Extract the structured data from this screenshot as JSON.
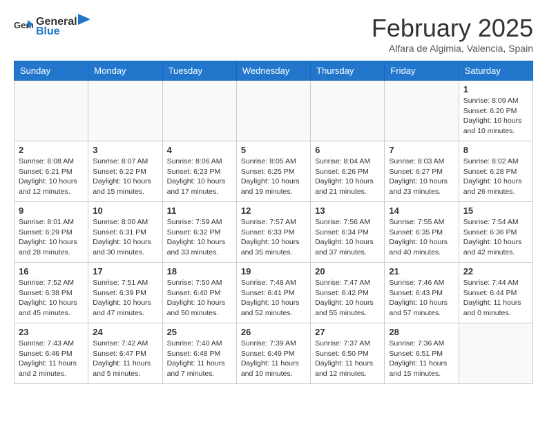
{
  "header": {
    "logo": {
      "general": "General",
      "blue": "Blue"
    },
    "month": "February 2025",
    "location": "Alfara de Algimia, Valencia, Spain"
  },
  "days_of_week": [
    "Sunday",
    "Monday",
    "Tuesday",
    "Wednesday",
    "Thursday",
    "Friday",
    "Saturday"
  ],
  "weeks": [
    [
      {
        "day": "",
        "info": ""
      },
      {
        "day": "",
        "info": ""
      },
      {
        "day": "",
        "info": ""
      },
      {
        "day": "",
        "info": ""
      },
      {
        "day": "",
        "info": ""
      },
      {
        "day": "",
        "info": ""
      },
      {
        "day": "1",
        "info": "Sunrise: 8:09 AM\nSunset: 6:20 PM\nDaylight: 10 hours\nand 10 minutes."
      }
    ],
    [
      {
        "day": "2",
        "info": "Sunrise: 8:08 AM\nSunset: 6:21 PM\nDaylight: 10 hours\nand 12 minutes."
      },
      {
        "day": "3",
        "info": "Sunrise: 8:07 AM\nSunset: 6:22 PM\nDaylight: 10 hours\nand 15 minutes."
      },
      {
        "day": "4",
        "info": "Sunrise: 8:06 AM\nSunset: 6:23 PM\nDaylight: 10 hours\nand 17 minutes."
      },
      {
        "day": "5",
        "info": "Sunrise: 8:05 AM\nSunset: 6:25 PM\nDaylight: 10 hours\nand 19 minutes."
      },
      {
        "day": "6",
        "info": "Sunrise: 8:04 AM\nSunset: 6:26 PM\nDaylight: 10 hours\nand 21 minutes."
      },
      {
        "day": "7",
        "info": "Sunrise: 8:03 AM\nSunset: 6:27 PM\nDaylight: 10 hours\nand 23 minutes."
      },
      {
        "day": "8",
        "info": "Sunrise: 8:02 AM\nSunset: 6:28 PM\nDaylight: 10 hours\nand 26 minutes."
      }
    ],
    [
      {
        "day": "9",
        "info": "Sunrise: 8:01 AM\nSunset: 6:29 PM\nDaylight: 10 hours\nand 28 minutes."
      },
      {
        "day": "10",
        "info": "Sunrise: 8:00 AM\nSunset: 6:31 PM\nDaylight: 10 hours\nand 30 minutes."
      },
      {
        "day": "11",
        "info": "Sunrise: 7:59 AM\nSunset: 6:32 PM\nDaylight: 10 hours\nand 33 minutes."
      },
      {
        "day": "12",
        "info": "Sunrise: 7:57 AM\nSunset: 6:33 PM\nDaylight: 10 hours\nand 35 minutes."
      },
      {
        "day": "13",
        "info": "Sunrise: 7:56 AM\nSunset: 6:34 PM\nDaylight: 10 hours\nand 37 minutes."
      },
      {
        "day": "14",
        "info": "Sunrise: 7:55 AM\nSunset: 6:35 PM\nDaylight: 10 hours\nand 40 minutes."
      },
      {
        "day": "15",
        "info": "Sunrise: 7:54 AM\nSunset: 6:36 PM\nDaylight: 10 hours\nand 42 minutes."
      }
    ],
    [
      {
        "day": "16",
        "info": "Sunrise: 7:52 AM\nSunset: 6:38 PM\nDaylight: 10 hours\nand 45 minutes."
      },
      {
        "day": "17",
        "info": "Sunrise: 7:51 AM\nSunset: 6:39 PM\nDaylight: 10 hours\nand 47 minutes."
      },
      {
        "day": "18",
        "info": "Sunrise: 7:50 AM\nSunset: 6:40 PM\nDaylight: 10 hours\nand 50 minutes."
      },
      {
        "day": "19",
        "info": "Sunrise: 7:48 AM\nSunset: 6:41 PM\nDaylight: 10 hours\nand 52 minutes."
      },
      {
        "day": "20",
        "info": "Sunrise: 7:47 AM\nSunset: 6:42 PM\nDaylight: 10 hours\nand 55 minutes."
      },
      {
        "day": "21",
        "info": "Sunrise: 7:46 AM\nSunset: 6:43 PM\nDaylight: 10 hours\nand 57 minutes."
      },
      {
        "day": "22",
        "info": "Sunrise: 7:44 AM\nSunset: 6:44 PM\nDaylight: 11 hours\nand 0 minutes."
      }
    ],
    [
      {
        "day": "23",
        "info": "Sunrise: 7:43 AM\nSunset: 6:46 PM\nDaylight: 11 hours\nand 2 minutes."
      },
      {
        "day": "24",
        "info": "Sunrise: 7:42 AM\nSunset: 6:47 PM\nDaylight: 11 hours\nand 5 minutes."
      },
      {
        "day": "25",
        "info": "Sunrise: 7:40 AM\nSunset: 6:48 PM\nDaylight: 11 hours\nand 7 minutes."
      },
      {
        "day": "26",
        "info": "Sunrise: 7:39 AM\nSunset: 6:49 PM\nDaylight: 11 hours\nand 10 minutes."
      },
      {
        "day": "27",
        "info": "Sunrise: 7:37 AM\nSunset: 6:50 PM\nDaylight: 11 hours\nand 12 minutes."
      },
      {
        "day": "28",
        "info": "Sunrise: 7:36 AM\nSunset: 6:51 PM\nDaylight: 11 hours\nand 15 minutes."
      },
      {
        "day": "",
        "info": ""
      }
    ]
  ]
}
